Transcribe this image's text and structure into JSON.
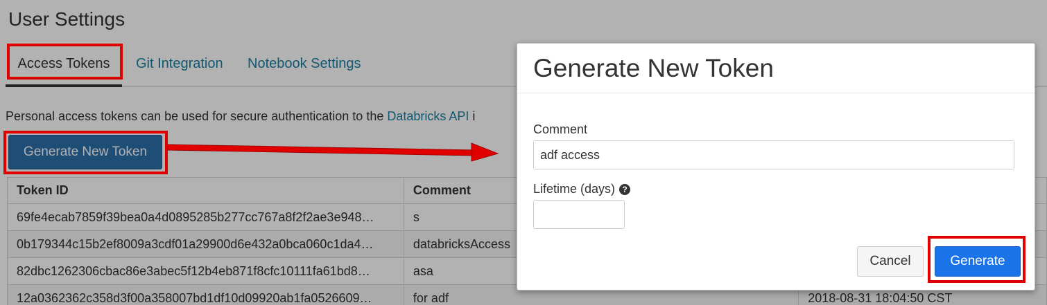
{
  "page": {
    "title": "User Settings",
    "tabs": [
      {
        "label": "Access Tokens",
        "active": true
      },
      {
        "label": "Git Integration",
        "active": false
      },
      {
        "label": "Notebook Settings",
        "active": false
      }
    ],
    "description_prefix": "Personal access tokens can be used for secure authentication to the ",
    "description_link": "Databricks API",
    "description_suffix": " i",
    "generate_button_label": "Generate New Token"
  },
  "table": {
    "headers": [
      "Token ID",
      "Comment"
    ],
    "rows": [
      {
        "id": "69fe4ecab7859f39bea0a4d0895285b277cc767a8f2f2ae3e948…",
        "comment": "s",
        "expiration": ""
      },
      {
        "id": "0b179344c15b2ef8009a3cdf01a29900d6e432a0bca060c1da4…",
        "comment": "databricksAccess",
        "expiration": ""
      },
      {
        "id": "82dbc1262306cbac86e3abec5f12b4eb871f8cfc10111fa61bd8…",
        "comment": "asa",
        "expiration": ""
      },
      {
        "id": "12a0362362c358d3f00a358007bd1df10d09920ab1fa0526609…",
        "comment": "for adf",
        "expiration": "2018-08-31 18:04:50 CST"
      }
    ]
  },
  "modal": {
    "title": "Generate New Token",
    "comment_label": "Comment",
    "comment_value": "adf access",
    "lifetime_label": "Lifetime (days)",
    "lifetime_value": "",
    "help_glyph": "?",
    "help_icon": "question-circle-icon",
    "cancel_label": "Cancel",
    "generate_label": "Generate"
  },
  "colors": {
    "link": "#1a7fa3",
    "primary_button": "#2b6faa",
    "generate_button": "#1a73e8",
    "annotation": "#e00000"
  }
}
